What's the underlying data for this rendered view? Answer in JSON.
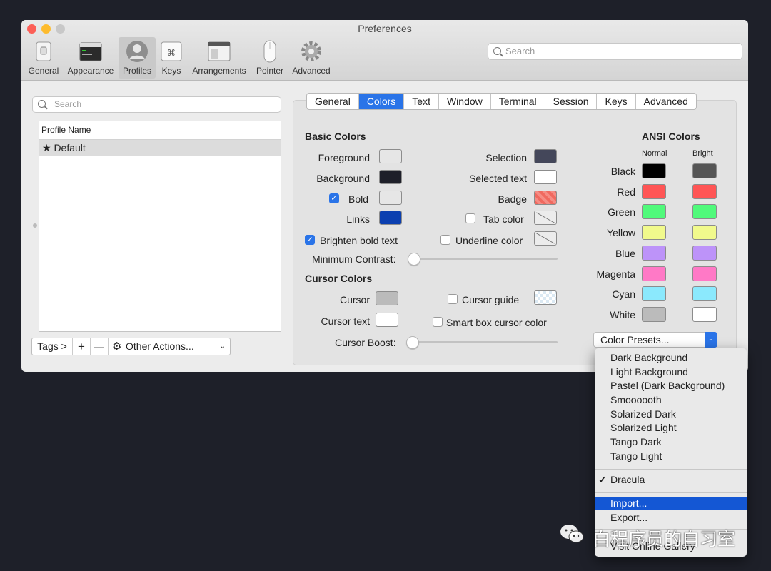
{
  "window": {
    "title": "Preferences"
  },
  "toolbar": {
    "items": [
      {
        "label": "General",
        "icon": "switch-icon"
      },
      {
        "label": "Appearance",
        "icon": "window-icon"
      },
      {
        "label": "Profiles",
        "icon": "user-icon"
      },
      {
        "label": "Keys",
        "icon": "command-key-icon"
      },
      {
        "label": "Arrangements",
        "icon": "arrangements-icon"
      },
      {
        "label": "Pointer",
        "icon": "mouse-icon"
      },
      {
        "label": "Advanced",
        "icon": "gear-icon"
      }
    ],
    "selected": "Profiles",
    "search_placeholder": "Search"
  },
  "profiles": {
    "search_placeholder": "Search",
    "column_header": "Profile Name",
    "items": [
      "★ Default"
    ],
    "tags_button": "Tags >",
    "add": "+",
    "remove": "—",
    "other_actions": "Other Actions..."
  },
  "tabs": [
    "General",
    "Colors",
    "Text",
    "Window",
    "Terminal",
    "Session",
    "Keys",
    "Advanced"
  ],
  "active_tab": "Colors",
  "basic_colors": {
    "heading": "Basic Colors",
    "foreground": "Foreground",
    "background": "Background",
    "bold": "Bold",
    "links": "Links",
    "selection": "Selection",
    "selected_text": "Selected text",
    "badge": "Badge",
    "tab_color": "Tab color",
    "brighten_bold": "Brighten bold text",
    "underline_color": "Underline color",
    "min_contrast": "Minimum Contrast:",
    "min_contrast_value": 0
  },
  "cursor_colors": {
    "heading": "Cursor Colors",
    "cursor": "Cursor",
    "cursor_text": "Cursor text",
    "cursor_guide": "Cursor guide",
    "smart_box": "Smart box cursor color",
    "cursor_boost": "Cursor Boost:",
    "cursor_boost_value": 0
  },
  "ansi": {
    "heading": "ANSI Colors",
    "normal_label": "Normal",
    "bright_label": "Bright",
    "rows": [
      {
        "name": "Black",
        "normal": "#000000",
        "bright": "#555555"
      },
      {
        "name": "Red",
        "normal": "#ff5555",
        "bright": "#ff5555"
      },
      {
        "name": "Green",
        "normal": "#50fa7b",
        "bright": "#50fa7b"
      },
      {
        "name": "Yellow",
        "normal": "#f1fa8c",
        "bright": "#f1fa8c"
      },
      {
        "name": "Blue",
        "normal": "#bd93f9",
        "bright": "#bd93f9"
      },
      {
        "name": "Magenta",
        "normal": "#ff79c6",
        "bright": "#ff79c6"
      },
      {
        "name": "Cyan",
        "normal": "#8be9fd",
        "bright": "#8be9fd"
      },
      {
        "name": "White",
        "normal": "#bbbbbb",
        "bright": "#ffffff"
      }
    ],
    "presets_button": "Color Presets..."
  },
  "colors": {
    "foreground": "#e6e6e6",
    "background": "#1e1f29",
    "bold": "#e6e6e6",
    "links": "#0b3fb0",
    "selection": "#44475a",
    "selected_text": "#ffffff",
    "badge": "#f0695f",
    "cursor": "#bbbbbb",
    "cursor_text": "#ffffff",
    "accent": "#2a74e8",
    "menu_highlight": "#1457d4"
  },
  "menu": {
    "items": [
      "Dark Background",
      "Light Background",
      "Pastel (Dark Background)",
      "Smoooooth",
      "Solarized Dark",
      "Solarized Light",
      "Tango Dark",
      "Tango Light"
    ],
    "checked": "Dracula",
    "import": "Import...",
    "export": "Export...",
    "gallery": "Visit Online Gallery"
  },
  "watermark": "白程序员的自习室"
}
